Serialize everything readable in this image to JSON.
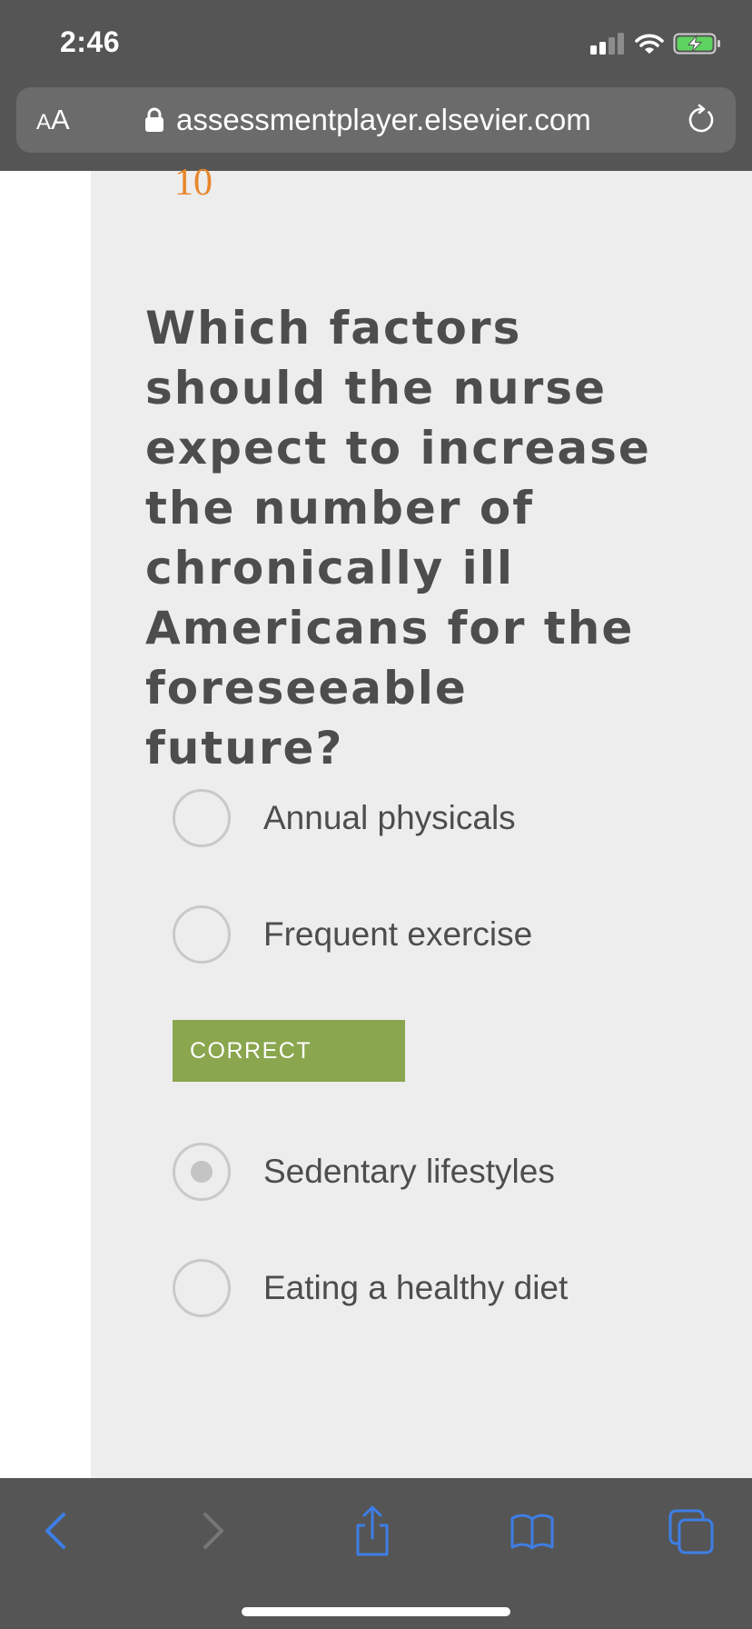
{
  "status_bar": {
    "time": "2:46"
  },
  "browser": {
    "text_size_button_small": "A",
    "text_size_button_large": "A",
    "url": "assessmentplayer.elsevier.com",
    "icons": [
      "lock-icon",
      "reload-icon",
      "signal-icon",
      "wifi-icon",
      "battery-charging-icon"
    ]
  },
  "question": {
    "number": "10",
    "text": "Which factors should the nurse expect to increase the number of chronically ill Americans for the foreseeable future?",
    "options": [
      {
        "label": "Annual physicals",
        "selected": false
      },
      {
        "label": "Frequent exercise",
        "selected": false
      },
      {
        "label": "Sedentary lifestyles",
        "selected": true
      },
      {
        "label": "Eating a healthy diet",
        "selected": false
      }
    ],
    "feedback_badge": "CORRECT"
  },
  "toolbar": {
    "icons": [
      "back-icon",
      "forward-icon",
      "share-icon",
      "bookmarks-icon",
      "tabs-icon"
    ]
  },
  "colors": {
    "chrome": "#555555",
    "panel": "#ededed",
    "question_number": "#e8862c",
    "correct_badge": "#8aa64e",
    "toolbar_active": "#3d7ee6",
    "toolbar_disabled": "#777777"
  }
}
